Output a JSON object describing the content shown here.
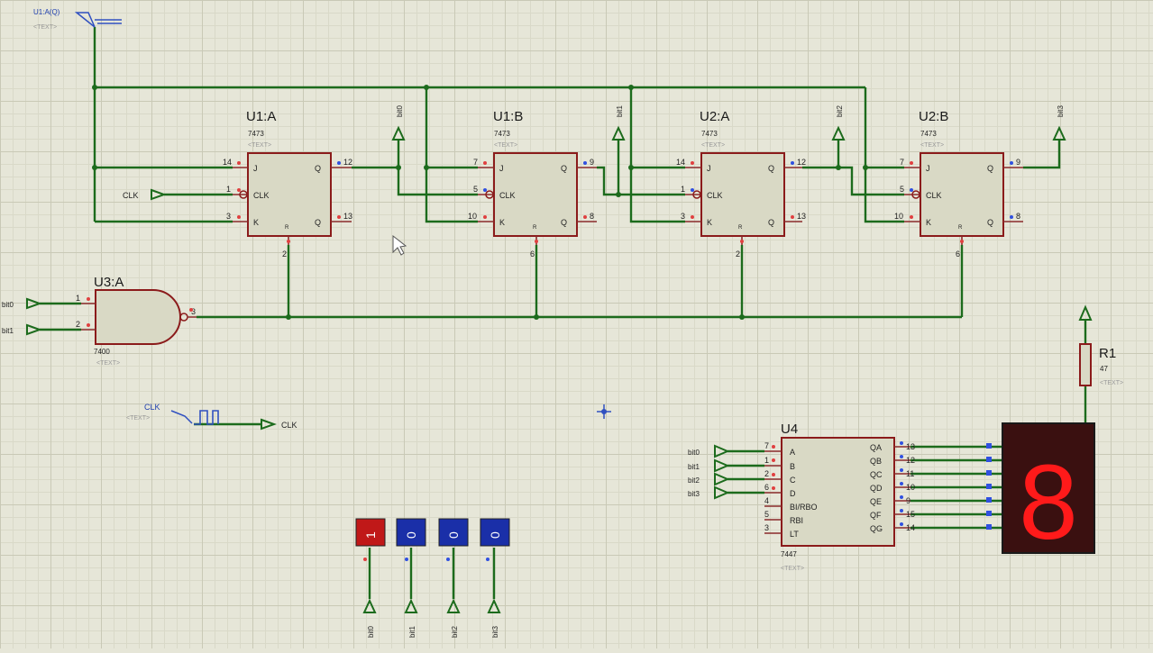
{
  "probe": {
    "label": "U1:A(Q)",
    "text": "<TEXT>"
  },
  "flipflops": [
    {
      "name": "U1:A",
      "part": "7473",
      "text": "<TEXT>",
      "pin_j": "14",
      "pin_clk": "1",
      "pin_k": "3",
      "pin_q": "12",
      "pin_qn": "13",
      "pin_r": "2",
      "bit": "bit0"
    },
    {
      "name": "U1:B",
      "part": "7473",
      "text": "<TEXT>",
      "pin_j": "7",
      "pin_clk": "5",
      "pin_k": "10",
      "pin_q": "9",
      "pin_qn": "8",
      "pin_r": "6",
      "bit": "bit1"
    },
    {
      "name": "U2:A",
      "part": "7473",
      "text": "<TEXT>",
      "pin_j": "14",
      "pin_clk": "1",
      "pin_k": "3",
      "pin_q": "12",
      "pin_qn": "13",
      "pin_r": "2",
      "bit": "bit2"
    },
    {
      "name": "U2:B",
      "part": "7473",
      "text": "<TEXT>",
      "pin_j": "7",
      "pin_clk": "5",
      "pin_k": "10",
      "pin_q": "9",
      "pin_qn": "8",
      "pin_r": "6",
      "bit": "bit3"
    }
  ],
  "pin_labels": {
    "j": "J",
    "clk": "CLK",
    "k": "K",
    "q": "Q",
    "qn": "Q",
    "r": "R"
  },
  "clk_terminal": "CLK",
  "nand": {
    "name": "U3:A",
    "part": "7400",
    "text": "<TEXT>",
    "in1": "bit0",
    "in2": "bit1",
    "pin1": "1",
    "pin2": "2",
    "pin_out": "3"
  },
  "clock_gen": {
    "label": "CLK",
    "text": "<TEXT>",
    "out_label": "CLK"
  },
  "decoder": {
    "name": "U4",
    "part": "7447",
    "text": "<TEXT>",
    "inputs": [
      {
        "label": "A",
        "pin": "7",
        "net": "bit0"
      },
      {
        "label": "B",
        "pin": "1",
        "net": "bit1"
      },
      {
        "label": "C",
        "pin": "2",
        "net": "bit2"
      },
      {
        "label": "D",
        "pin": "6",
        "net": "bit3"
      },
      {
        "label": "BI/RBO",
        "pin": "4",
        "net": ""
      },
      {
        "label": "RBI",
        "pin": "5",
        "net": ""
      },
      {
        "label": "LT",
        "pin": "3",
        "net": ""
      }
    ],
    "outputs": [
      {
        "label": "QA",
        "pin": "13"
      },
      {
        "label": "QB",
        "pin": "12"
      },
      {
        "label": "QC",
        "pin": "11"
      },
      {
        "label": "QD",
        "pin": "10"
      },
      {
        "label": "QE",
        "pin": "9"
      },
      {
        "label": "QF",
        "pin": "15"
      },
      {
        "label": "QG",
        "pin": "14"
      }
    ]
  },
  "resistor": {
    "name": "R1",
    "value": "47",
    "text": "<TEXT>"
  },
  "display": {
    "digit": "8",
    "color": "#ff1a1a"
  },
  "logic_states": [
    {
      "value": "1",
      "net": "bit0",
      "color": "#c01818"
    },
    {
      "value": "0",
      "net": "bit1",
      "color": "#1a2fa8"
    },
    {
      "value": "0",
      "net": "bit2",
      "color": "#1a2fa8"
    },
    {
      "value": "0",
      "net": "bit3",
      "color": "#1a2fa8"
    }
  ],
  "colors": {
    "wire": "#1c6b1c",
    "chip_border": "#8b1b1b",
    "chip_fill": "#d9d9c5",
    "background": "#e6e6d8"
  }
}
